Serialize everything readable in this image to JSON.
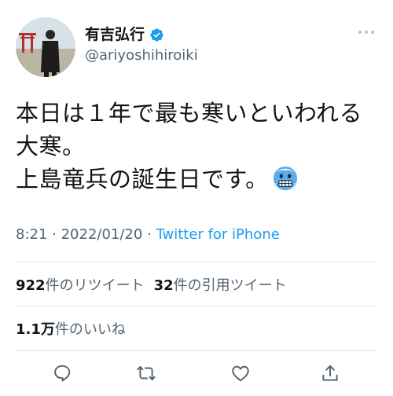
{
  "author": {
    "display_name": "有吉弘行",
    "handle": "@ariyoshihiroiki",
    "verified": true
  },
  "tweet": {
    "line1": "本日は１年で最も寒いといわれる",
    "line2": "大寒。",
    "line3": "上島竜兵の誕生日です。",
    "emoji": "cold-face"
  },
  "meta": {
    "time": "8:21",
    "sep1": " · ",
    "date": "2022/01/20",
    "sep2": " · ",
    "source": "Twitter for iPhone"
  },
  "stats": {
    "retweets_count": "922",
    "retweets_label": "件のリツイート",
    "quotes_count": "32",
    "quotes_label": "件の引用ツイート",
    "likes_count": "1.1万",
    "likes_label": "件のいいね"
  },
  "colors": {
    "accent": "#1d9bf0",
    "secondary_text": "#536471",
    "divider": "#e1e5e8"
  },
  "actions": [
    "reply-icon",
    "retweet-icon",
    "like-icon",
    "share-icon"
  ]
}
